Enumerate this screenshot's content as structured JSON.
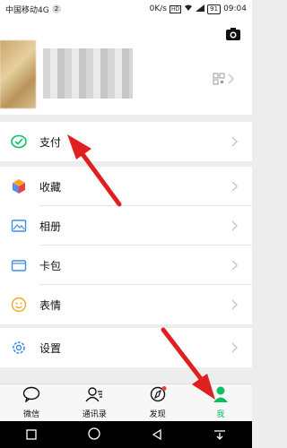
{
  "status_bar": {
    "carrier": "中国移动4G",
    "sim_badge": "2",
    "speed": "0K/s",
    "hd": "HD",
    "battery": "91",
    "time": "09:04"
  },
  "menu": [
    {
      "label": "支付",
      "icon": "wechat-pay-icon"
    },
    {
      "label": "收藏",
      "icon": "favorites-cube-icon"
    },
    {
      "label": "相册",
      "icon": "album-icon"
    },
    {
      "label": "卡包",
      "icon": "card-wallet-icon"
    },
    {
      "label": "表情",
      "icon": "emoji-smile-icon"
    },
    {
      "label": "设置",
      "icon": "settings-gear-icon"
    }
  ],
  "tabs": [
    {
      "label": "微信",
      "icon": "chat-bubble-icon"
    },
    {
      "label": "通讯录",
      "icon": "contacts-icon"
    },
    {
      "label": "发现",
      "icon": "compass-icon"
    },
    {
      "label": "我",
      "icon": "person-icon",
      "active": true
    }
  ],
  "colors": {
    "accent": "#07c160",
    "annotation_arrow": "#e02020"
  }
}
